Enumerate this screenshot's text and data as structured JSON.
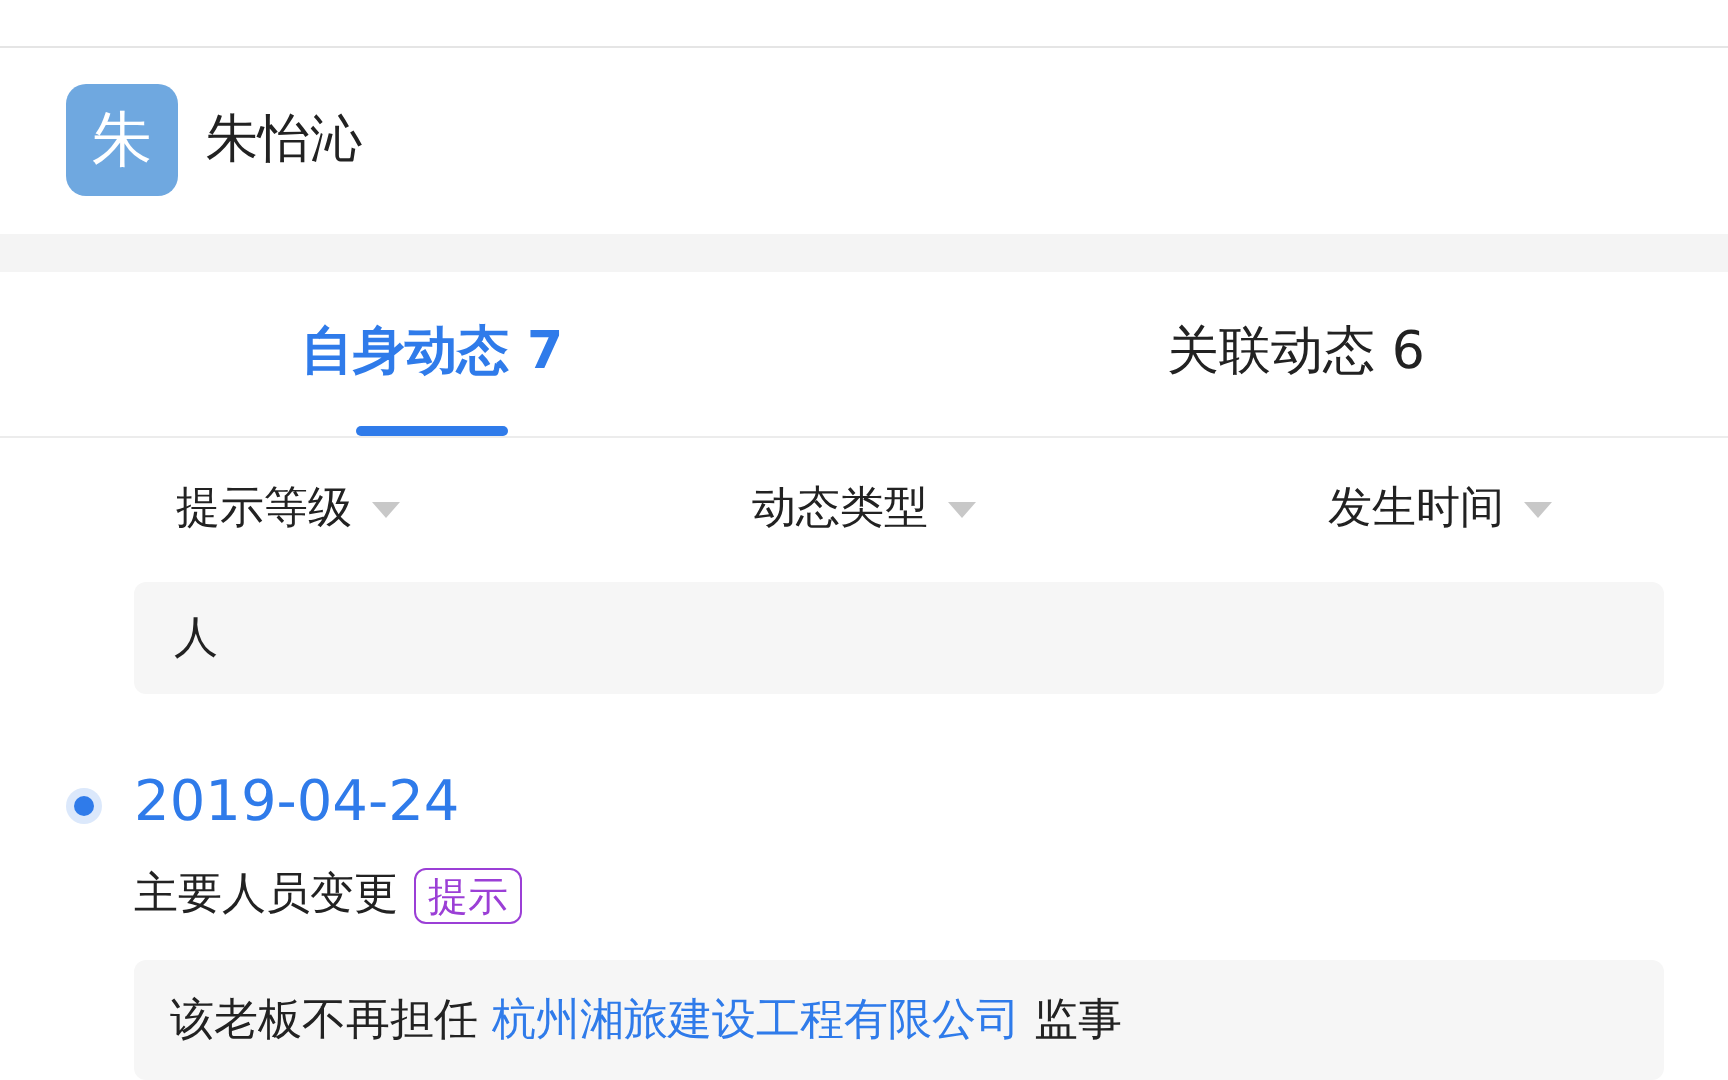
{
  "profile": {
    "avatar": "朱",
    "name": "朱怡沁"
  },
  "tabs": [
    {
      "label": "自身动态 7",
      "selected": true
    },
    {
      "label": "关联动态 6",
      "selected": false
    }
  ],
  "filters": [
    "提示等级",
    "动态类型",
    "发生时间"
  ],
  "previous_card": {
    "text": "人"
  },
  "events": [
    {
      "date": "2019-04-24",
      "title": "主要人员变更",
      "tag": "提示",
      "detail": {
        "before": "该老板不再担任",
        "link": "杭州湘旅建设工程有限公司",
        "after": "监事"
      }
    }
  ]
}
